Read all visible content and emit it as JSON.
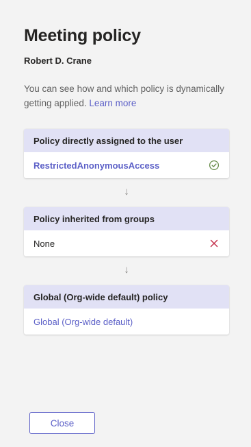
{
  "header": {
    "title": "Meeting policy",
    "user_name": "Robert D. Crane"
  },
  "description": {
    "text": "You can see how and which policy is dynamically getting applied.",
    "link_label": "Learn more"
  },
  "policies": [
    {
      "heading": "Policy directly assigned to the user",
      "value": "RestrictedAnonymousAccess",
      "status": "applied",
      "status_icon": "check-circle-icon",
      "status_color": "#6b8e4e"
    },
    {
      "heading": "Policy inherited from groups",
      "value": "None",
      "status": "not-applied",
      "status_icon": "cross-icon",
      "status_color": "#c4314b"
    },
    {
      "heading": "Global (Org-wide default) policy",
      "value": "Global (Org-wide default)"
    }
  ],
  "flow_arrow": "↓",
  "footer": {
    "close_label": "Close"
  },
  "colors": {
    "accent": "#5b5fc7",
    "card_header": "#e1e1f5",
    "background": "#f3f3f3"
  }
}
